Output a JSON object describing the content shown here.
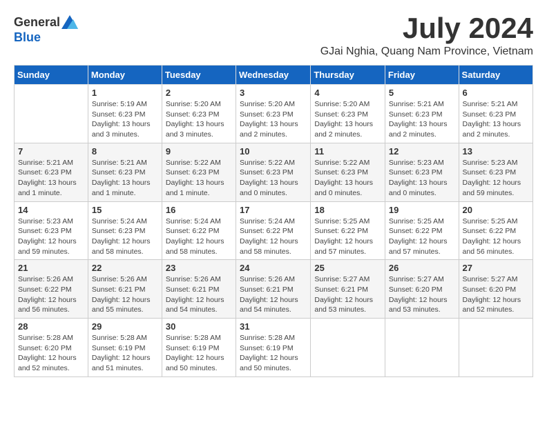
{
  "logo": {
    "general": "General",
    "blue": "Blue"
  },
  "title": {
    "month_year": "July 2024",
    "location": "GJai Nghia, Quang Nam Province, Vietnam"
  },
  "headers": [
    "Sunday",
    "Monday",
    "Tuesday",
    "Wednesday",
    "Thursday",
    "Friday",
    "Saturday"
  ],
  "weeks": [
    [
      {
        "day": "",
        "info": ""
      },
      {
        "day": "1",
        "info": "Sunrise: 5:19 AM\nSunset: 6:23 PM\nDaylight: 13 hours\nand 3 minutes."
      },
      {
        "day": "2",
        "info": "Sunrise: 5:20 AM\nSunset: 6:23 PM\nDaylight: 13 hours\nand 3 minutes."
      },
      {
        "day": "3",
        "info": "Sunrise: 5:20 AM\nSunset: 6:23 PM\nDaylight: 13 hours\nand 2 minutes."
      },
      {
        "day": "4",
        "info": "Sunrise: 5:20 AM\nSunset: 6:23 PM\nDaylight: 13 hours\nand 2 minutes."
      },
      {
        "day": "5",
        "info": "Sunrise: 5:21 AM\nSunset: 6:23 PM\nDaylight: 13 hours\nand 2 minutes."
      },
      {
        "day": "6",
        "info": "Sunrise: 5:21 AM\nSunset: 6:23 PM\nDaylight: 13 hours\nand 2 minutes."
      }
    ],
    [
      {
        "day": "7",
        "info": "Sunrise: 5:21 AM\nSunset: 6:23 PM\nDaylight: 13 hours\nand 1 minute."
      },
      {
        "day": "8",
        "info": "Sunrise: 5:21 AM\nSunset: 6:23 PM\nDaylight: 13 hours\nand 1 minute."
      },
      {
        "day": "9",
        "info": "Sunrise: 5:22 AM\nSunset: 6:23 PM\nDaylight: 13 hours\nand 1 minute."
      },
      {
        "day": "10",
        "info": "Sunrise: 5:22 AM\nSunset: 6:23 PM\nDaylight: 13 hours\nand 0 minutes."
      },
      {
        "day": "11",
        "info": "Sunrise: 5:22 AM\nSunset: 6:23 PM\nDaylight: 13 hours\nand 0 minutes."
      },
      {
        "day": "12",
        "info": "Sunrise: 5:23 AM\nSunset: 6:23 PM\nDaylight: 13 hours\nand 0 minutes."
      },
      {
        "day": "13",
        "info": "Sunrise: 5:23 AM\nSunset: 6:23 PM\nDaylight: 12 hours\nand 59 minutes."
      }
    ],
    [
      {
        "day": "14",
        "info": "Sunrise: 5:23 AM\nSunset: 6:23 PM\nDaylight: 12 hours\nand 59 minutes."
      },
      {
        "day": "15",
        "info": "Sunrise: 5:24 AM\nSunset: 6:23 PM\nDaylight: 12 hours\nand 58 minutes."
      },
      {
        "day": "16",
        "info": "Sunrise: 5:24 AM\nSunset: 6:22 PM\nDaylight: 12 hours\nand 58 minutes."
      },
      {
        "day": "17",
        "info": "Sunrise: 5:24 AM\nSunset: 6:22 PM\nDaylight: 12 hours\nand 58 minutes."
      },
      {
        "day": "18",
        "info": "Sunrise: 5:25 AM\nSunset: 6:22 PM\nDaylight: 12 hours\nand 57 minutes."
      },
      {
        "day": "19",
        "info": "Sunrise: 5:25 AM\nSunset: 6:22 PM\nDaylight: 12 hours\nand 57 minutes."
      },
      {
        "day": "20",
        "info": "Sunrise: 5:25 AM\nSunset: 6:22 PM\nDaylight: 12 hours\nand 56 minutes."
      }
    ],
    [
      {
        "day": "21",
        "info": "Sunrise: 5:26 AM\nSunset: 6:22 PM\nDaylight: 12 hours\nand 56 minutes."
      },
      {
        "day": "22",
        "info": "Sunrise: 5:26 AM\nSunset: 6:21 PM\nDaylight: 12 hours\nand 55 minutes."
      },
      {
        "day": "23",
        "info": "Sunrise: 5:26 AM\nSunset: 6:21 PM\nDaylight: 12 hours\nand 54 minutes."
      },
      {
        "day": "24",
        "info": "Sunrise: 5:26 AM\nSunset: 6:21 PM\nDaylight: 12 hours\nand 54 minutes."
      },
      {
        "day": "25",
        "info": "Sunrise: 5:27 AM\nSunset: 6:21 PM\nDaylight: 12 hours\nand 53 minutes."
      },
      {
        "day": "26",
        "info": "Sunrise: 5:27 AM\nSunset: 6:20 PM\nDaylight: 12 hours\nand 53 minutes."
      },
      {
        "day": "27",
        "info": "Sunrise: 5:27 AM\nSunset: 6:20 PM\nDaylight: 12 hours\nand 52 minutes."
      }
    ],
    [
      {
        "day": "28",
        "info": "Sunrise: 5:28 AM\nSunset: 6:20 PM\nDaylight: 12 hours\nand 52 minutes."
      },
      {
        "day": "29",
        "info": "Sunrise: 5:28 AM\nSunset: 6:19 PM\nDaylight: 12 hours\nand 51 minutes."
      },
      {
        "day": "30",
        "info": "Sunrise: 5:28 AM\nSunset: 6:19 PM\nDaylight: 12 hours\nand 50 minutes."
      },
      {
        "day": "31",
        "info": "Sunrise: 5:28 AM\nSunset: 6:19 PM\nDaylight: 12 hours\nand 50 minutes."
      },
      {
        "day": "",
        "info": ""
      },
      {
        "day": "",
        "info": ""
      },
      {
        "day": "",
        "info": ""
      }
    ]
  ]
}
